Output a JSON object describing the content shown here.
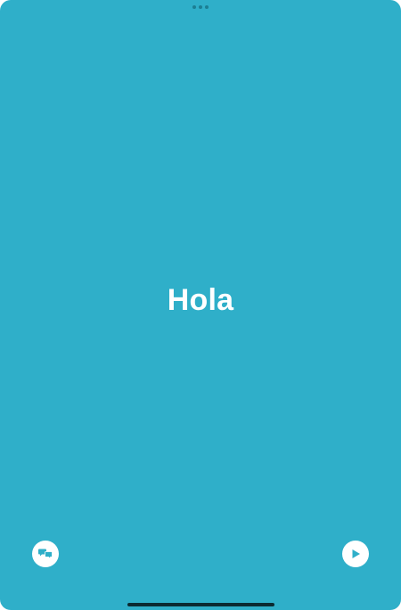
{
  "card": {
    "phrase": "Hola",
    "background_color": "#2fafc9"
  },
  "controls": {
    "left_button_icon": "speech-bubbles-icon",
    "right_button_icon": "play-icon"
  }
}
